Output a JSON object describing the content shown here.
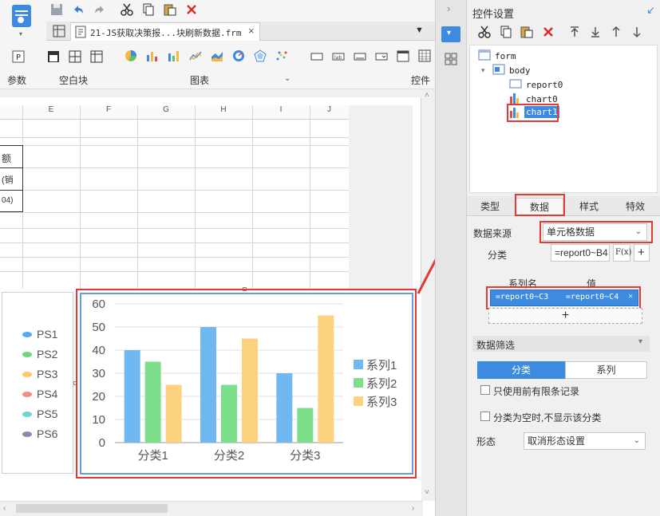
{
  "toolbar": {
    "doc_tab": "21-JS获取决策报...块刷新数据.frm",
    "groups": {
      "param": "参数",
      "blank": "空白块",
      "chart": "图表",
      "control": "控件"
    }
  },
  "sheet": {
    "columns": [
      "E",
      "F",
      "G",
      "H",
      "I",
      "J"
    ],
    "cells": [
      "额",
      "(销",
      "04)"
    ]
  },
  "legend_left": [
    "PS1",
    "PS2",
    "PS3",
    "PS4",
    "PS5",
    "PS6"
  ],
  "legend_left_colors": [
    "#5aaaf0",
    "#6ed67a",
    "#fbc96a",
    "#f98b85",
    "#6fd6d0",
    "#8b8bb0"
  ],
  "chart_data": {
    "type": "bar",
    "categories": [
      "分类1",
      "分类2",
      "分类3"
    ],
    "series": [
      {
        "name": "系列1",
        "values": [
          40,
          50,
          30
        ],
        "color": "#6fb8f2"
      },
      {
        "name": "系列2",
        "values": [
          35,
          25,
          15
        ],
        "color": "#7ddf8c"
      },
      {
        "name": "系列3",
        "values": [
          25,
          45,
          55
        ],
        "color": "#fcd27f"
      }
    ],
    "ylim": [
      0,
      60
    ],
    "yticks": [
      "0",
      "10",
      "20",
      "30",
      "40",
      "50",
      "60"
    ],
    "legend": "right",
    "grid": true
  },
  "panel": {
    "title": "控件设置",
    "tree": {
      "form": "form",
      "body": "body",
      "report0": "report0",
      "chart0": "chart0",
      "chart1": "chart1"
    },
    "tabs": [
      "类型",
      "数据",
      "样式",
      "特效"
    ],
    "data_source_label": "数据来源",
    "data_source_value": "单元格数据",
    "category_label": "分类",
    "category_value": "=report0~B4",
    "fx_label": "F(x)",
    "series_name_header": "系列名",
    "value_header": "值",
    "series_name_value": "=report0~C3",
    "series_value_value": "=report0~C4",
    "filter_label": "数据筛选",
    "filter_tab_category": "分类",
    "filter_tab_series": "系列",
    "check_limited": "只使用前有限条记录",
    "check_empty": "分类为空时,不显示该分类",
    "shape_label": "形态",
    "shape_value": "取消形态设置"
  }
}
